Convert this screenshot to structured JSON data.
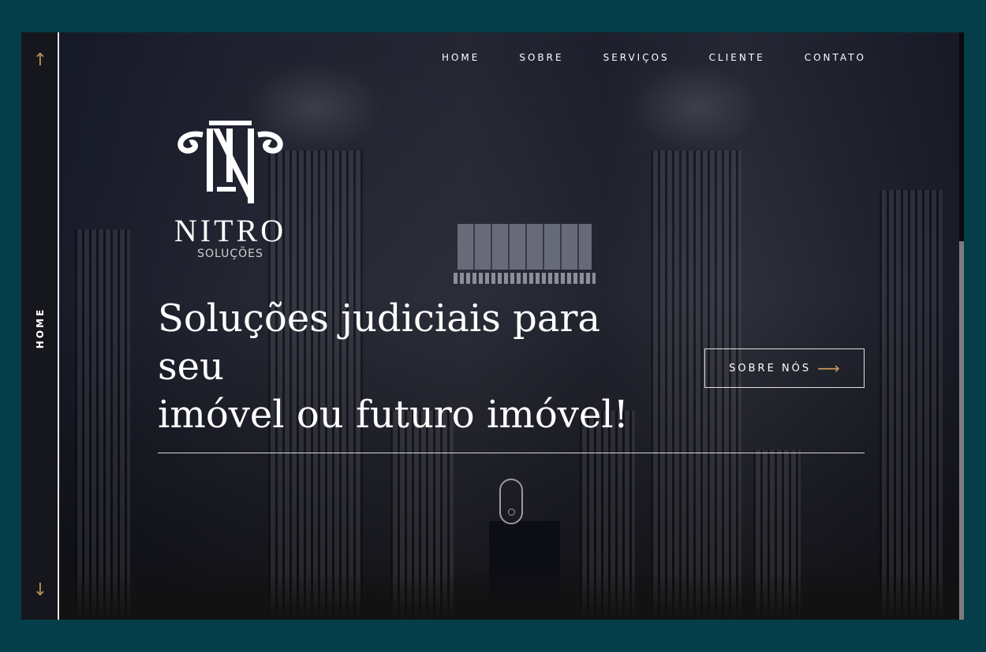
{
  "nav": {
    "items": [
      "HOME",
      "SOBRE",
      "SERVIÇOS",
      "CLIENTE",
      "CONTATO"
    ]
  },
  "rail": {
    "section_label": "HOME",
    "up_icon": "arrow-up-icon",
    "down_icon": "arrow-down-icon"
  },
  "brand": {
    "name": "NITRO",
    "subtitle": "SOLUÇÕES"
  },
  "hero": {
    "title_line1": "Soluções judiciais para seu",
    "title_line2": "imóvel ou futuro imóvel!",
    "cta_label": "SOBRE NÓS",
    "cta_icon": "arrow-right-icon"
  },
  "colors": {
    "page_bg": "#033e49",
    "accent": "#c59a5e",
    "text": "#ffffff"
  }
}
